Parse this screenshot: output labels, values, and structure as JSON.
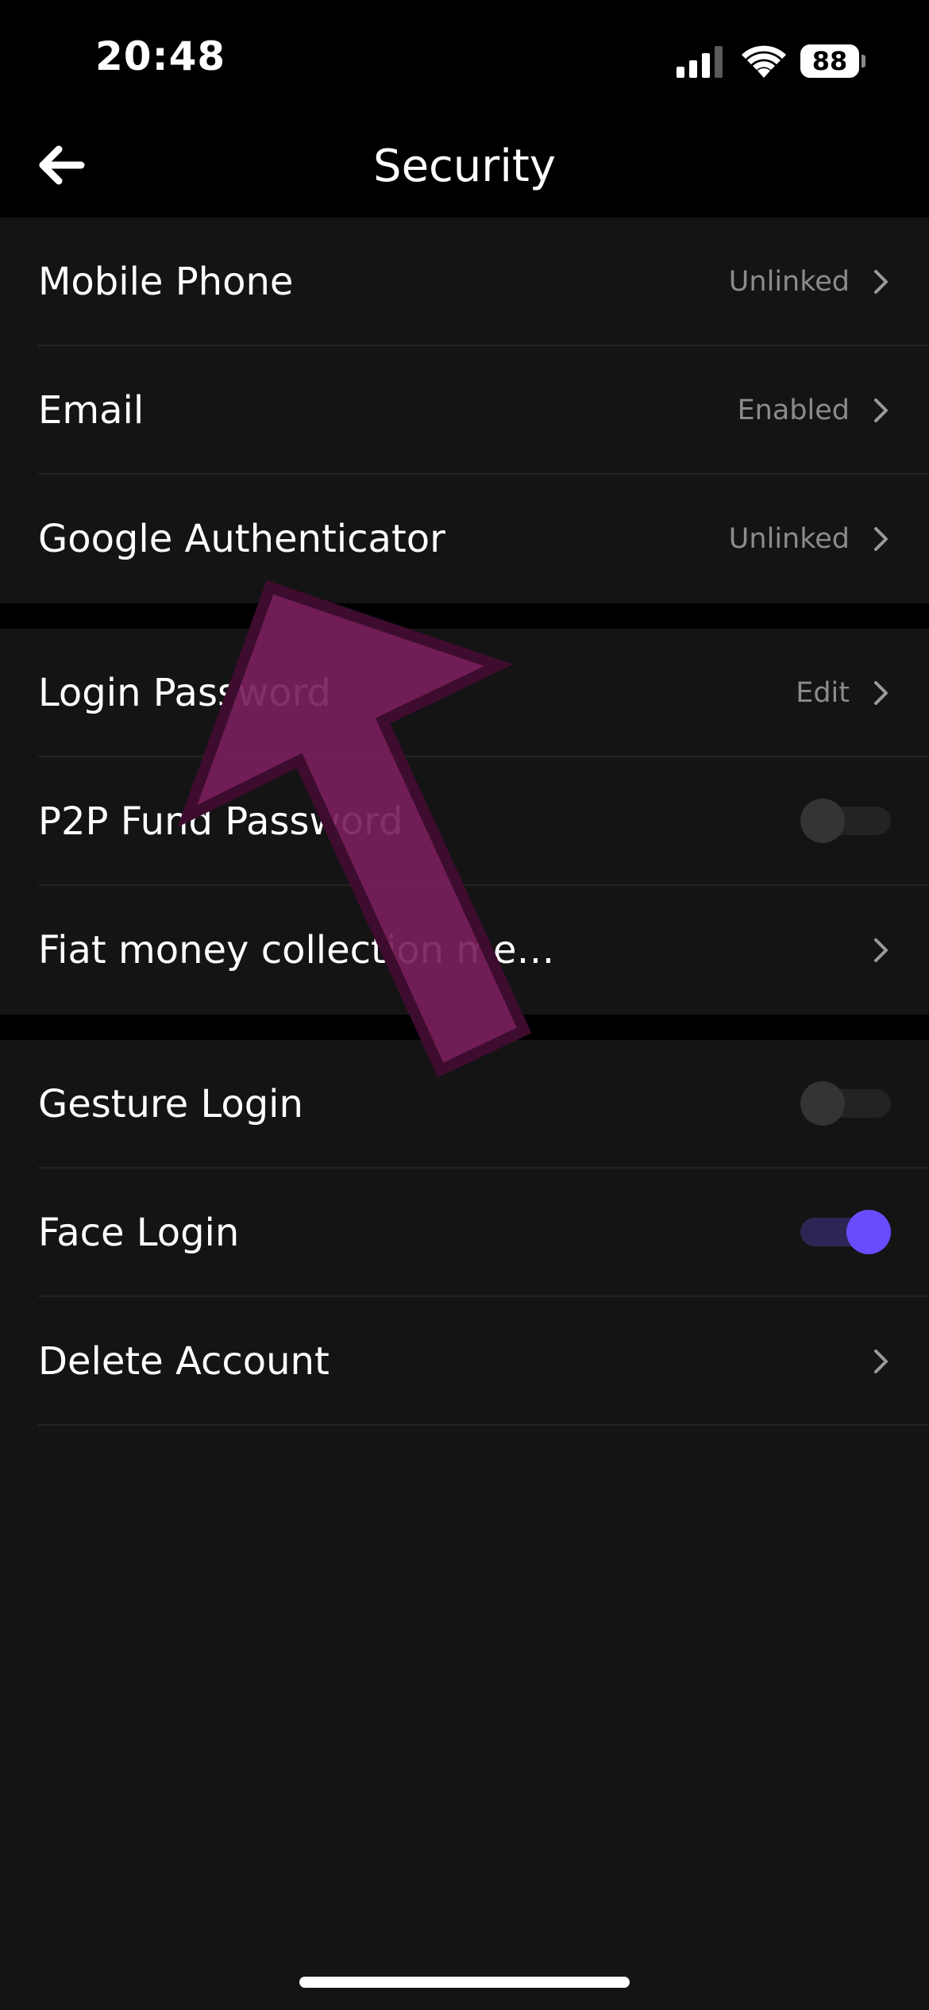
{
  "status_bar": {
    "time": "20:48",
    "battery": "88"
  },
  "nav": {
    "title": "Security",
    "back_icon": "arrow-left-icon"
  },
  "groups": [
    {
      "rows": [
        {
          "label": "Mobile Phone",
          "value": "Unlinked",
          "control": "chevron"
        },
        {
          "label": "Email",
          "value": "Enabled",
          "control": "chevron"
        },
        {
          "label": "Google Authenticator",
          "value": "Unlinked",
          "control": "chevron"
        }
      ]
    },
    {
      "rows": [
        {
          "label": "Login Password",
          "value": "Edit",
          "control": "chevron"
        },
        {
          "label": "P2P Fund Password",
          "control": "toggle",
          "on": false
        },
        {
          "label": "Fiat money collection me…",
          "control": "chevron"
        }
      ]
    },
    {
      "rows": [
        {
          "label": "Gesture Login",
          "control": "toggle",
          "on": false
        },
        {
          "label": "Face Login",
          "control": "toggle",
          "on": true
        },
        {
          "label": "Delete Account",
          "control": "chevron"
        }
      ]
    }
  ],
  "colors": {
    "background": "#000000",
    "group_background": "#141414",
    "toggle_on": "#6a4cff",
    "overlay_arrow": "#7a1f5c"
  },
  "overlay": {
    "icon": "pointer-arrow-icon"
  }
}
